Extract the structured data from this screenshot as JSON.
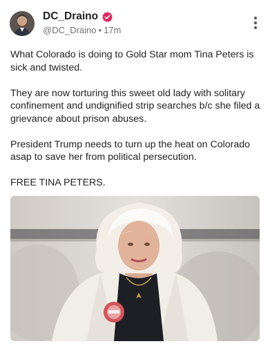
{
  "post": {
    "author": {
      "display_name": "DC_Draino",
      "handle": "@DC_Draino",
      "time_ago": "17m",
      "separator": "•",
      "verified_badge_icon": "verified-badge-icon",
      "avatar_icon": "avatar-image"
    },
    "more_icon": "vertical-ellipsis-icon",
    "paragraphs": [
      "What Colorado is doing to Gold Star mom Tina Peters is sick and twisted.",
      "They are now torturing this sweet old lady with solitary confinement and undignified strip searches b/c she filed a grievance about prison abuses.",
      "President Trump needs to turn up the heat on Colorado asap to save her from political persecution.",
      "FREE TINA PETERS."
    ]
  },
  "colors": {
    "badge": "#e0245e",
    "meta": "#6f6f6f",
    "text": "#222222"
  }
}
